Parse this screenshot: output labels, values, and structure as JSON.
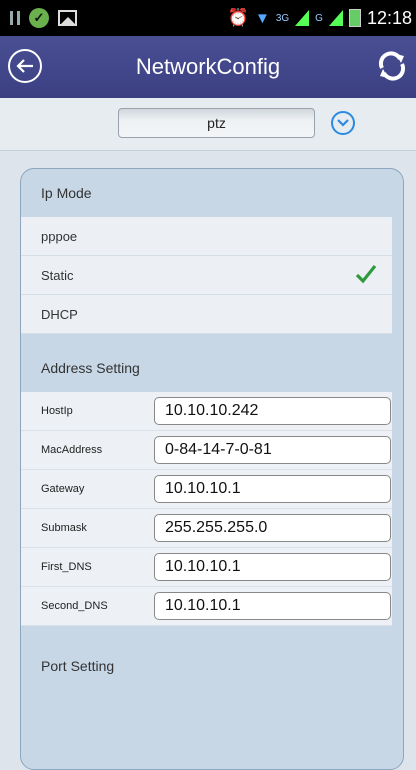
{
  "status_bar": {
    "time": "12:18",
    "network_3g": "3G",
    "network_g": "G"
  },
  "header": {
    "title": "NetworkConfig"
  },
  "device": {
    "selected": "ptz"
  },
  "ip_mode": {
    "heading": "Ip Mode",
    "options": [
      {
        "label": "pppoe",
        "selected": false
      },
      {
        "label": "Static",
        "selected": true
      },
      {
        "label": "DHCP",
        "selected": false
      }
    ]
  },
  "address": {
    "heading": "Address Setting",
    "fields": [
      {
        "label": "HostIp",
        "value": "10.10.10.242"
      },
      {
        "label": "MacAddress",
        "value": "0-84-14-7-0-81"
      },
      {
        "label": "Gateway",
        "value": "10.10.10.1"
      },
      {
        "label": "Submask",
        "value": "255.255.255.0"
      },
      {
        "label": "First_DNS",
        "value": "10.10.10.1"
      },
      {
        "label": "Second_DNS",
        "value": "10.10.10.1"
      }
    ]
  },
  "port": {
    "heading": "Port Setting"
  },
  "colors": {
    "header": "#3f4387",
    "check": "#2e9a3e",
    "accent": "#2a8be0"
  }
}
